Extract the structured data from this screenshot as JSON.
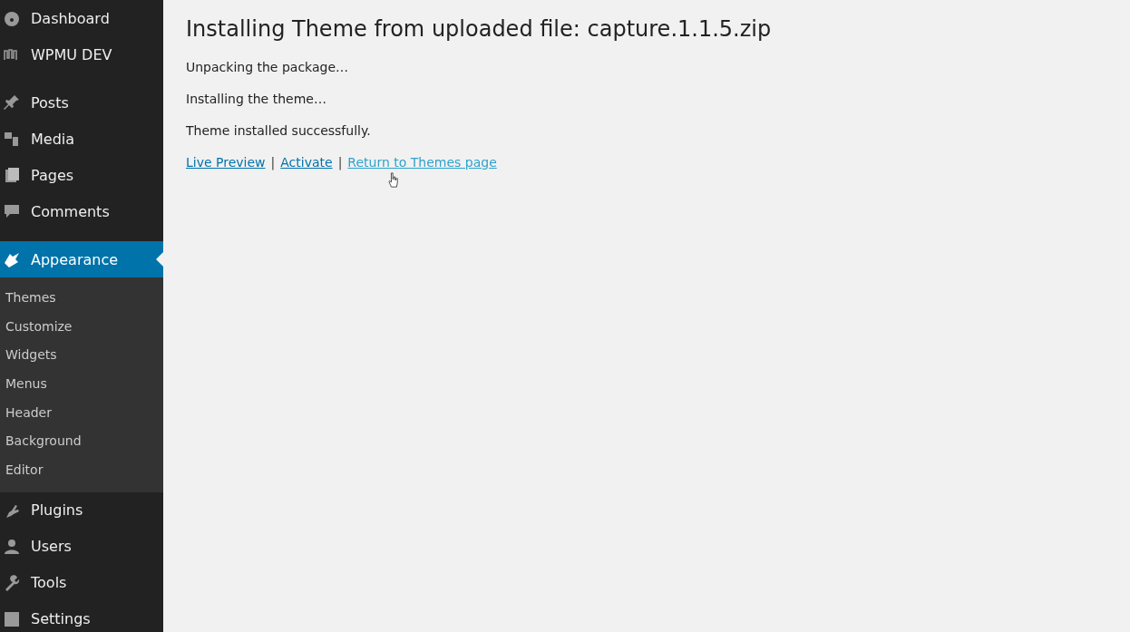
{
  "sidebar": {
    "menu_groups": [
      [
        {
          "label": "Dashboard",
          "selected": false
        },
        {
          "label": "WPMU DEV",
          "selected": false
        }
      ],
      [
        {
          "label": "Posts",
          "selected": false
        },
        {
          "label": "Media",
          "selected": false
        },
        {
          "label": "Pages",
          "selected": false
        },
        {
          "label": "Comments",
          "selected": false
        }
      ],
      [
        {
          "label": "Appearance",
          "selected": true,
          "children": [
            {
              "label": "Themes"
            },
            {
              "label": "Customize"
            },
            {
              "label": "Widgets"
            },
            {
              "label": "Menus"
            },
            {
              "label": "Header"
            },
            {
              "label": "Background"
            },
            {
              "label": "Editor"
            }
          ]
        },
        {
          "label": "Plugins",
          "selected": false
        },
        {
          "label": "Users",
          "selected": false
        },
        {
          "label": "Tools",
          "selected": false
        },
        {
          "label": "Settings",
          "selected": false
        }
      ]
    ]
  },
  "main": {
    "title": "Installing Theme from uploaded file: capture.1.1.5.zip",
    "messages": [
      "Unpacking the package…",
      "Installing the theme…",
      "Theme installed successfully."
    ],
    "links": [
      {
        "label": "Live Preview",
        "hovered": false
      },
      {
        "label": "Activate",
        "hovered": false
      },
      {
        "label": "Return to Themes page",
        "hovered": true
      }
    ],
    "separators": [
      "|",
      "|"
    ]
  }
}
